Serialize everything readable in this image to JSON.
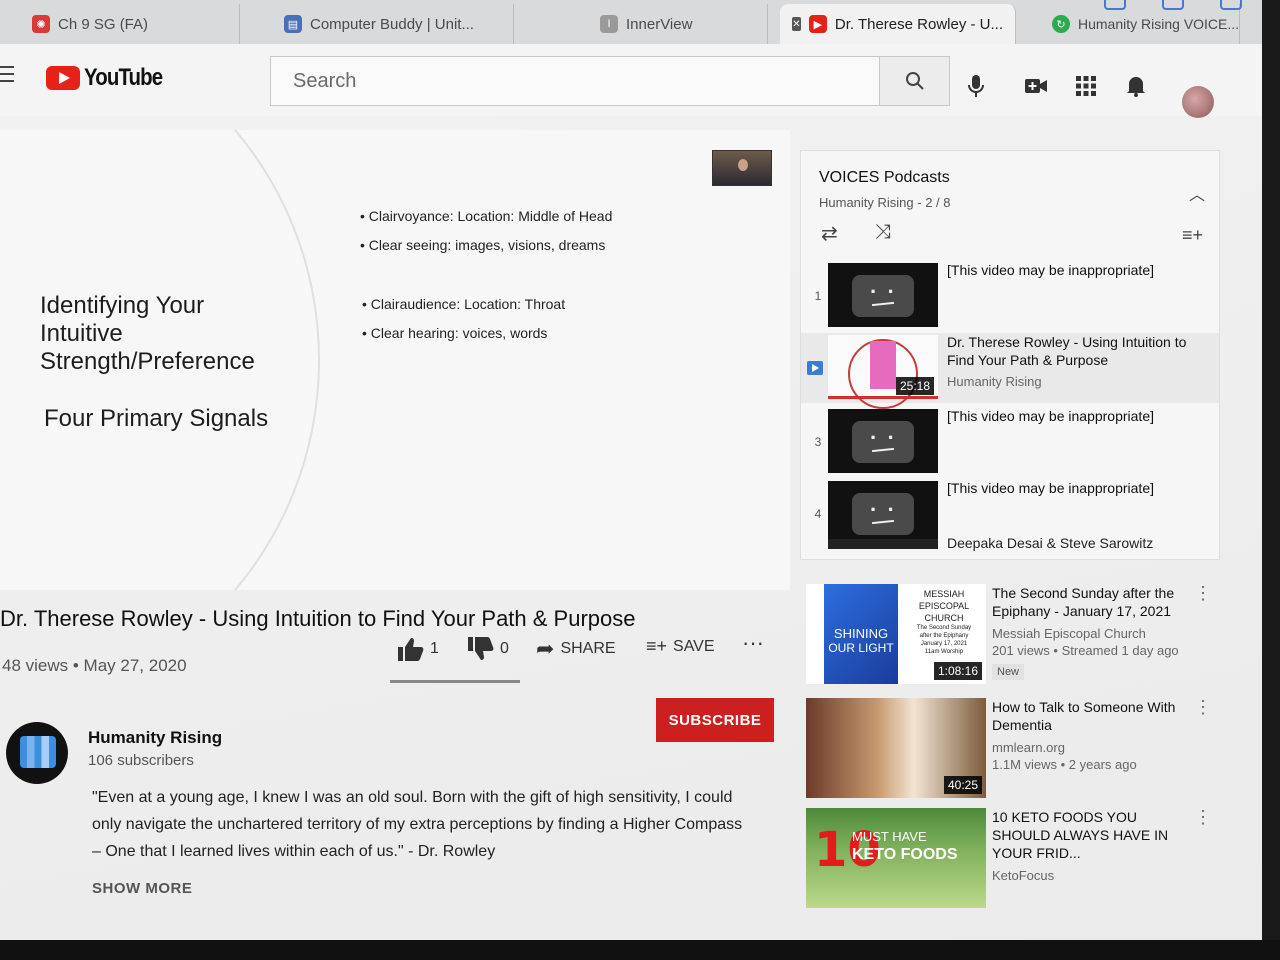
{
  "tabs": [
    {
      "label": "Ch 9 SG (FA)",
      "icon": "canvas-icon",
      "color": "#d83a3a"
    },
    {
      "label": "Computer Buddy | Unit...",
      "icon": "page-icon",
      "color": "#4a6fb2"
    },
    {
      "label": "InnerView",
      "icon": "page-icon",
      "color": "#9a9a9a"
    },
    {
      "label": "Dr. Therese Rowley - U...",
      "icon": "youtube-icon",
      "color": "#e62117"
    },
    {
      "label": "Humanity Rising VOICE...",
      "icon": "refresh-icon",
      "color": "#2eaa4c"
    }
  ],
  "masthead": {
    "logo": "YouTube",
    "search_placeholder": "Search"
  },
  "slide": {
    "title": "Identifying Your Intuitive Strength/Preference",
    "subtitle": "Four Primary Signals",
    "bullets": [
      "Clairvoyance: Location: Middle of Head",
      "Clear seeing: images, visions, dreams",
      "Clairaudience: Location: Throat",
      "Clear hearing: voices, words"
    ]
  },
  "playlist": {
    "title": "VOICES Podcasts",
    "subtitle": "Humanity Rising - 2 / 8",
    "items": [
      {
        "index": "1",
        "title": "[This video may be inappropriate]",
        "channel": "",
        "duration": ""
      },
      {
        "index": "",
        "title": "Dr. Therese Rowley - Using Intuition to Find Your Path & Purpose",
        "channel": "Humanity Rising",
        "duration": "25:18"
      },
      {
        "index": "3",
        "title": "[This video may be inappropriate]",
        "channel": "",
        "duration": ""
      },
      {
        "index": "4",
        "title": "[This video may be inappropriate]",
        "channel": "",
        "duration": ""
      }
    ],
    "partial_item": "Deepaka Desai & Steve Sarowitz"
  },
  "video": {
    "title": "Dr. Therese Rowley - Using Intuition to Find Your Path & Purpose",
    "meta": "48 views • May 27, 2020",
    "likes": "1",
    "dislikes": "0",
    "share": "SHARE",
    "save": "SAVE"
  },
  "channel": {
    "name": "Humanity Rising",
    "subscribers": "106 subscribers",
    "subscribe_label": "SUBSCRIBE"
  },
  "description": {
    "lines": [
      "\"Even at a young age, I knew I was an old soul. Born with the gift of high sensitivity, I could",
      "only navigate the unchartered territory of my extra perceptions by finding a Higher Compass",
      "– One that I learned lives within each of us.\" - Dr. Rowley"
    ],
    "show_more": "SHOW MORE"
  },
  "suggested": [
    {
      "title": "The Second Sunday after the Epiphany - January 17, 2021",
      "channel": "Messiah Episcopal Church",
      "stats": "201 views • Streamed 1 day ago",
      "badge": "New",
      "duration": "1:08:16",
      "thumb_text": [
        "SHINING",
        "OUR LIGHT"
      ],
      "thumb_church": [
        "MESSIAH",
        "EPISCOPAL",
        "CHURCH",
        "The Second Sunday",
        "after the Epiphany",
        "January 17, 2021",
        "11am Worship"
      ]
    },
    {
      "title": "How to Talk to Someone With Dementia",
      "channel": "mmlearn.org",
      "stats": "1.1M views • 2 years ago",
      "badge": "",
      "duration": "40:25"
    },
    {
      "title": "10 KETO FOODS YOU SHOULD ALWAYS HAVE IN YOUR FRID...",
      "channel": "KetoFocus",
      "stats": "",
      "badge": "",
      "duration": "",
      "thumb_text": [
        "10",
        "MUST HAVE",
        "KETO FOODS"
      ]
    }
  ]
}
